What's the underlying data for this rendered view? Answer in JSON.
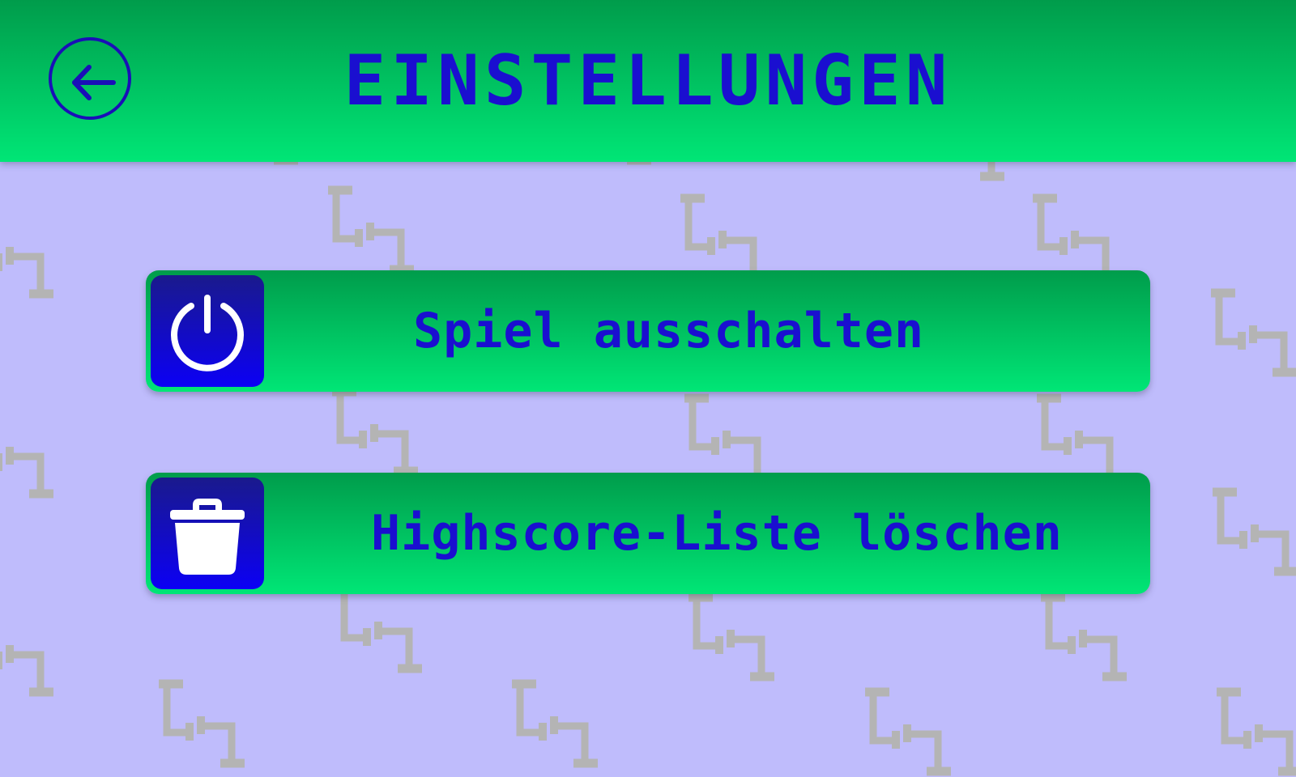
{
  "header": {
    "title": "EINSTELLUNGEN",
    "back_icon": "arrow-left-icon"
  },
  "menu": {
    "items": [
      {
        "label": "Spiel ausschalten",
        "icon": "power-icon"
      },
      {
        "label": "Highscore-Liste löschen",
        "icon": "trash-icon"
      }
    ]
  },
  "colors": {
    "background": "#bfbcfc",
    "green_top": "#009c4b",
    "green_bottom": "#00e676",
    "text_blue": "#1a0fd0",
    "icon_box_top": "#1a1a8c",
    "icon_box_bottom": "#0c00f5",
    "pattern_gray": "#b4b4b4"
  }
}
